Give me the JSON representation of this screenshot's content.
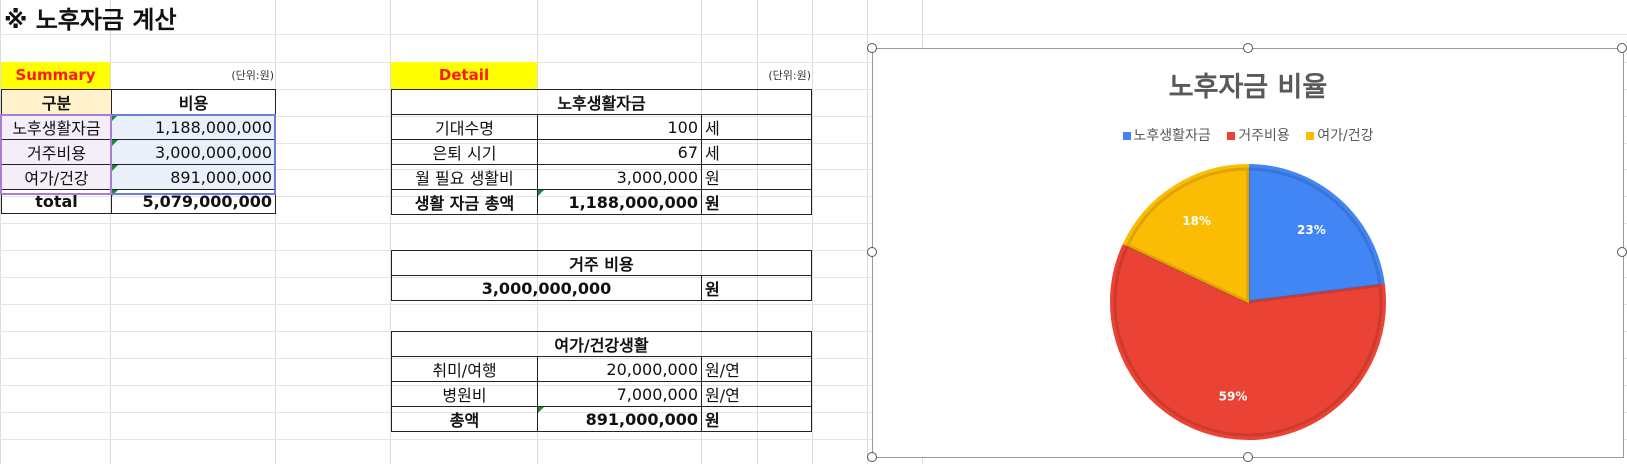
{
  "sheet_title": "※ 노후자금 계산",
  "summary": {
    "label": "Summary",
    "unit": "(단위:원)",
    "headers": [
      "구분",
      "비용"
    ],
    "rows": [
      {
        "name": "노후생활자금",
        "value": "1,188,000,000"
      },
      {
        "name": "거주비용",
        "value": "3,000,000,000"
      },
      {
        "name": "여가/건강",
        "value": "891,000,000"
      }
    ],
    "total": {
      "name": "total",
      "value": "5,079,000,000"
    }
  },
  "detail": {
    "label": "Detail",
    "unit": "(단위:원)",
    "living": {
      "title": "노후생활자금",
      "rows": [
        {
          "name": "기대수명",
          "value": "100",
          "unit": "세"
        },
        {
          "name": "은퇴 시기",
          "value": "67",
          "unit": "세"
        },
        {
          "name": "월 필요 생활비",
          "value": "3,000,000",
          "unit": "원"
        }
      ],
      "total": {
        "name": "생활 자금 총액",
        "value": "1,188,000,000",
        "unit": "원"
      }
    },
    "housing": {
      "title": "거주 비용",
      "value": "3,000,000,000",
      "unit": "원"
    },
    "leisure": {
      "title": "여가/건강생활",
      "rows": [
        {
          "name": "취미/여행",
          "value": "20,000,000",
          "unit": "원/연"
        },
        {
          "name": "병원비",
          "value": "7,000,000",
          "unit": "원/연"
        }
      ],
      "total": {
        "name": "총액",
        "value": "891,000,000",
        "unit": "원"
      }
    }
  },
  "chart_data": {
    "type": "pie",
    "title": "노후자금 비율",
    "categories": [
      "노후생활자금",
      "거주비용",
      "여가/건강"
    ],
    "values": [
      23,
      59,
      18
    ],
    "labels": [
      "23%",
      "59%",
      "18%"
    ],
    "colors": [
      "#4285f4",
      "#ea4335",
      "#fbbc04"
    ],
    "legend_position": "top"
  }
}
